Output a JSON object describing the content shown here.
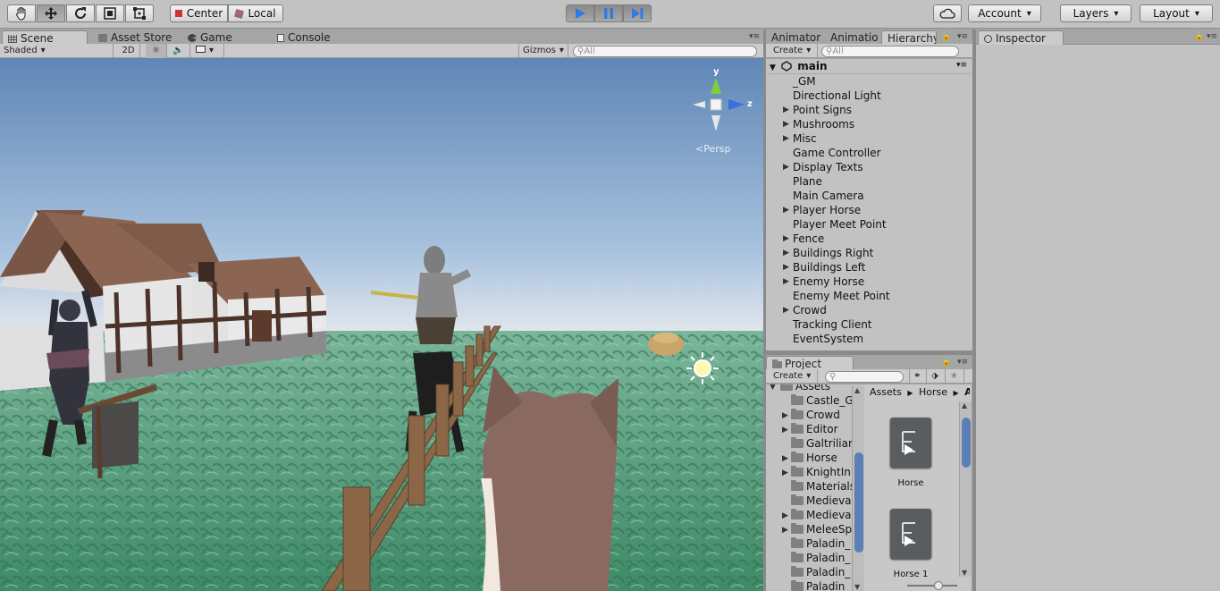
{
  "toolbar": {
    "tools": [
      "hand-tool-icon",
      "move-tool-icon",
      "rotate-tool-icon",
      "scale-tool-icon",
      "rect-tool-icon"
    ],
    "pivot_label": "Center",
    "space_label": "Local",
    "account_label": "Account",
    "layers_label": "Layers",
    "layout_label": "Layout",
    "play_color": "#2f7be6"
  },
  "scene_tabs": [
    "Scene",
    "Asset Store",
    "Game",
    "Console"
  ],
  "scene_strip": {
    "shading": "Shaded",
    "mode_2d": "2D",
    "gizmos": "Gizmos",
    "search_placeholder": "All"
  },
  "scene": {
    "gizmo_x": "y",
    "gizmo_z": "z",
    "projection": "Persp"
  },
  "hierarchy_tabs": [
    "Animator",
    "Animatio",
    "Hierarchy"
  ],
  "hierarchy": {
    "create_label": "Create",
    "search_placeholder": "All",
    "scene_name": "main",
    "items": [
      {
        "label": "_GM",
        "expandable": false
      },
      {
        "label": "Directional Light",
        "expandable": false
      },
      {
        "label": "Point Signs",
        "expandable": true
      },
      {
        "label": "Mushrooms",
        "expandable": true
      },
      {
        "label": "Misc",
        "expandable": true
      },
      {
        "label": "Game Controller",
        "expandable": false
      },
      {
        "label": "Display Texts",
        "expandable": true
      },
      {
        "label": "Plane",
        "expandable": false
      },
      {
        "label": "Main Camera",
        "expandable": false
      },
      {
        "label": "Player Horse",
        "expandable": true
      },
      {
        "label": "Player Meet Point",
        "expandable": false
      },
      {
        "label": "Fence",
        "expandable": true
      },
      {
        "label": "Buildings Right",
        "expandable": true
      },
      {
        "label": "Buildings Left",
        "expandable": true
      },
      {
        "label": "Enemy Horse",
        "expandable": true
      },
      {
        "label": "Enemy Meet Point",
        "expandable": false
      },
      {
        "label": "Crowd",
        "expandable": true
      },
      {
        "label": "Tracking Client",
        "expandable": false
      },
      {
        "label": "EventSystem",
        "expandable": false
      }
    ]
  },
  "project": {
    "tab_label": "Project",
    "create_label": "Create",
    "folders": [
      {
        "label": "Assets",
        "expandable": false
      },
      {
        "label": "Castle_G",
        "expandable": false
      },
      {
        "label": "Crowd",
        "expandable": true
      },
      {
        "label": "Editor",
        "expandable": true
      },
      {
        "label": "Galtriliar",
        "expandable": false
      },
      {
        "label": "Horse",
        "expandable": true
      },
      {
        "label": "KnightIn",
        "expandable": true
      },
      {
        "label": "Materials",
        "expandable": false
      },
      {
        "label": "Medieval",
        "expandable": false
      },
      {
        "label": "Medieval",
        "expandable": true
      },
      {
        "label": "MeleeSp",
        "expandable": true
      },
      {
        "label": "Paladin_",
        "expandable": false
      },
      {
        "label": "Paladin_",
        "expandable": false
      },
      {
        "label": "Paladin_",
        "expandable": false
      },
      {
        "label": "Paladin",
        "expandable": false
      }
    ],
    "breadcrumb": [
      "Assets",
      "Horse",
      "A"
    ],
    "assets": [
      "Horse",
      "Horse 1"
    ]
  },
  "inspector": {
    "tab_label": "Inspector"
  }
}
